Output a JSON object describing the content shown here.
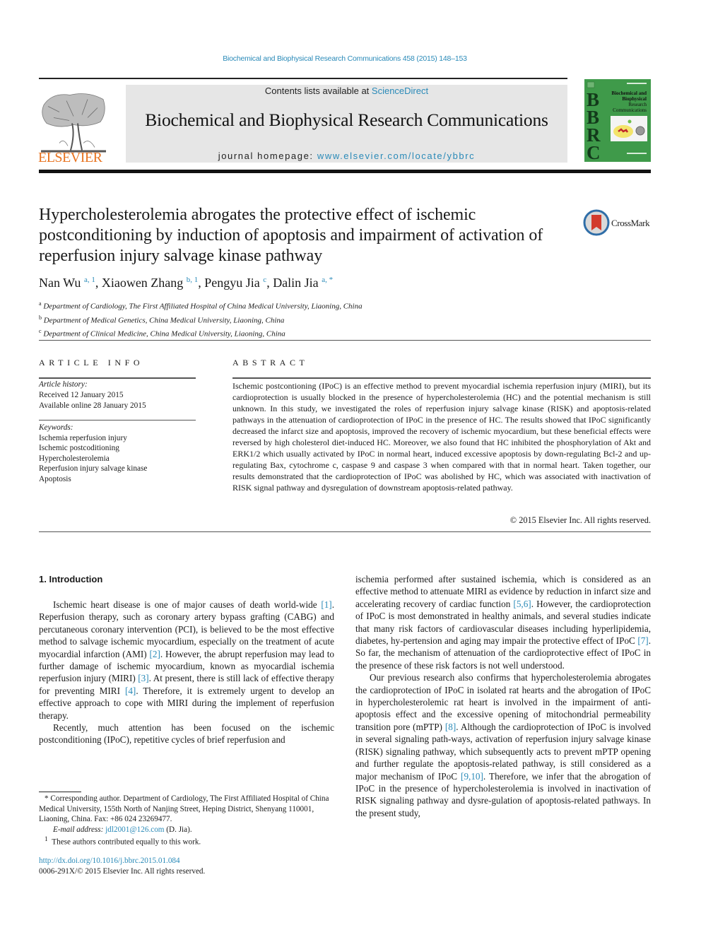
{
  "header": {
    "citation": "Biochemical and Biophysical Research Communications 458 (2015) 148–153",
    "contents_prefix": "Contents lists available at ",
    "contents_link": "ScienceDirect",
    "journal_title": "Biochemical and Biophysical Research Communications",
    "homepage_prefix": "journal homepage: ",
    "homepage_link": "www.elsevier.com/locate/ybbrc",
    "publisher_logo_text": "ELSEVIER",
    "cover_letters": "BBRC",
    "cover_title": "Biochemical and Biophysical Research Communications",
    "crossmark_label": "CrossMark",
    "colors": {
      "link": "#2a8ab8",
      "elsevier_orange": "#e8731f",
      "cover_green": "#3f9a4a",
      "banner_gray": "#e6e6e6"
    }
  },
  "article": {
    "title": "Hypercholesterolemia abrogates the protective effect of ischemic postconditioning by induction of apoptosis and impairment of activation of reperfusion injury salvage kinase pathway",
    "authors": [
      {
        "name": "Nan Wu",
        "marks": "a, 1"
      },
      {
        "name": "Xiaowen Zhang",
        "marks": "b, 1"
      },
      {
        "name": "Pengyu Jia",
        "marks": "c"
      },
      {
        "name": "Dalin Jia",
        "marks": "a, *"
      }
    ],
    "affiliations": [
      {
        "mark": "a",
        "text": "Department of Cardiology, The First Affiliated Hospital of China Medical University, Liaoning, China"
      },
      {
        "mark": "b",
        "text": "Department of Medical Genetics, China Medical University, Liaoning, China"
      },
      {
        "mark": "c",
        "text": "Department of Clinical Medicine, China Medical University, Liaoning, China"
      }
    ]
  },
  "article_info": {
    "heading": "ARTICLE INFO",
    "history_label": "Article history:",
    "received": "Received 12 January 2015",
    "available": "Available online 28 January 2015",
    "keywords_label": "Keywords:",
    "keywords": [
      "Ischemia reperfusion injury",
      "Ischemic postcoditioning",
      "Hypercholesterolemia",
      "Reperfusion injury salvage kinase",
      "Apoptosis"
    ]
  },
  "abstract": {
    "heading": "ABSTRACT",
    "text": "Ischemic postcontioning (IPoC) is an effective method to prevent myocardial ischemia reperfusion injury (MIRI), but its cardioprotection is usually blocked in the presence of hypercholesterolemia (HC) and the potential mechanism is still unknown. In this study, we investigated the roles of reperfusion injury salvage kinase (RISK) and apoptosis-related pathways in the attenuation of cardioprotection of IPoC in the presence of HC. The results showed that IPoC significantly decreased the infarct size and apoptosis, improved the recovery of ischemic myocardium, but these beneficial effects were reversed by high cholesterol diet-induced HC. Moreover, we also found that HC inhibited the phosphorylation of Akt and ERK1/2 which usually activated by IPoC in normal heart, induced excessive apoptosis by down-regulating Bcl-2 and up-regulating Bax, cytochrome c, caspase 9 and caspase 3 when compared with that in normal heart. Taken together, our results demonstrated that the cardioprotection of IPoC was abolished by HC, which was associated with inactivation of RISK signal pathway and dysregulation of downstream apoptosis-related pathway.",
    "copyright": "© 2015 Elsevier Inc. All rights reserved."
  },
  "intro": {
    "heading": "1.  Introduction",
    "left_p1": [
      "Ischemic heart disease is one of major causes of death world-wide ",
      "[1]",
      ". Reperfusion therapy, such as coronary artery bypass grafting (CABG) and percutaneous coronary intervention (PCI), is believed to be the most effective method to salvage ischemic myocardium, especially on the treatment of acute myocardial infarction (AMI) ",
      "[2]",
      ". However, the abrupt reperfusion may lead to further damage of ischemic myocardium, known as myocardial ischemia reperfusion injury (MIRI) ",
      "[3]",
      ". At present, there is still lack of effective therapy for preventing MIRI ",
      "[4]",
      ". Therefore, it is extremely urgent to develop an effective approach to cope with MIRI during the implement of reperfusion therapy."
    ],
    "left_p2": "Recently, much attention has been focused on the ischemic postconditioning (IPoC), repetitive cycles of brief reperfusion and",
    "right_p1": [
      "ischemia performed after sustained ischemia, which is considered as an effective method to attenuate MIRI as evidence by reduction in infarct size and accelerating recovery of cardiac function ",
      "[5,6]",
      ". However, the cardioprotection of IPoC is most demonstrated in healthy animals, and several studies indicate that many risk factors of cardiovascular diseases including hyperlipidemia, diabetes, hy-pertension and aging may impair the protective effect of IPoC ",
      "[7]",
      ". So far, the mechanism of attenuation of the cardioprotective effect of IPoC in the presence of these risk factors is not well understood."
    ],
    "right_p2": [
      "Our previous research also confirms that hypercholesterolemia abrogates the cardioprotection of IPoC in isolated rat hearts and the abrogation of IPoC in hypercholesterolemic rat heart is involved in the impairment of anti-apoptosis effect and the excessive opening of mitochondrial permeability transition pore (mPTP) ",
      "[8]",
      ". Although the cardioprotection of IPoC is involved in several signaling path-ways, activation of reperfusion injury salvage kinase (RISK) signaling pathway, which subsequently acts to prevent mPTP opening and further regulate the apoptosis-related pathway, is still considered as a major mechanism of IPoC ",
      "[9,10]",
      ". Therefore, we infer that the abrogation of IPoC in the presence of hypercholesterolemia is involved in inactivation of RISK signaling pathway and dysre-gulation of apoptosis-related pathways. In the present study,"
    ]
  },
  "footnotes": {
    "corresponding": "* Corresponding author. Department of Cardiology, The First Affiliated Hospital of China Medical University, 155th North of Nanjing Street, Heping District, Shenyang 110001, Liaoning, China. Fax: +86 024 23269477.",
    "email_label": "E-mail address: ",
    "email": "jdl2001@126.com",
    "email_suffix": " (D. Jia).",
    "equal_mark": "1",
    "equal_text": "These authors contributed equally to this work.",
    "doi": "http://dx.doi.org/10.1016/j.bbrc.2015.01.084",
    "issn_line": "0006-291X/© 2015 Elsevier Inc. All rights reserved."
  }
}
